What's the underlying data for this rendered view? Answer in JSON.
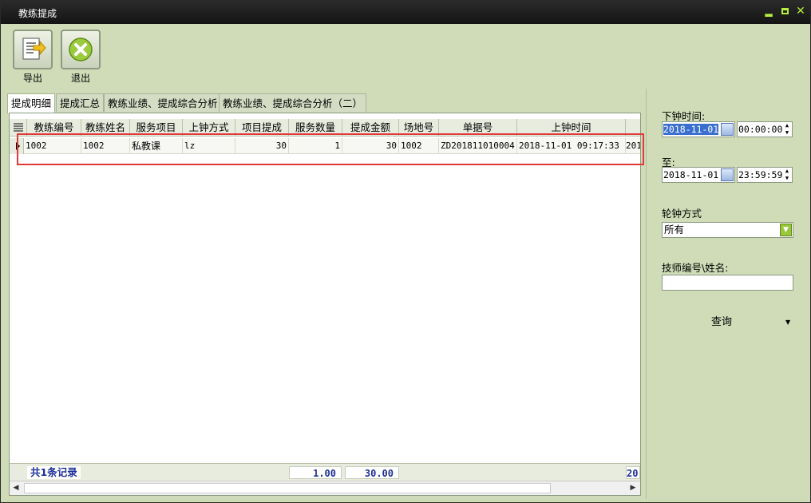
{
  "window": {
    "title": "教练提成",
    "controls": {
      "minimize": "▂",
      "close": "✕"
    }
  },
  "toolbar": {
    "export_label": "导出",
    "exit_label": "退出"
  },
  "tabs": [
    {
      "label": "提成明细",
      "active": true
    },
    {
      "label": "提成汇总",
      "active": false
    },
    {
      "label": "教练业绩、提成综合分析",
      "active": false
    },
    {
      "label": "教练业绩、提成综合分析（二）",
      "active": false
    }
  ],
  "grid": {
    "columns": [
      "教练编号",
      "教练姓名",
      "服务项目",
      "上钟方式",
      "项目提成",
      "服务数量",
      "提成金额",
      "场地号",
      "单据号",
      "上钟时间"
    ],
    "rows": [
      {
        "coach_id": "1002",
        "coach_name": "1002",
        "service": "私教课",
        "clock_mode": "lz",
        "item_commission": "30",
        "quantity": "1",
        "commission_amount": "30",
        "venue": "1002",
        "receipt_no": "ZD201811010004",
        "clock_time": "2018-11-01 09:17:33",
        "overflow": "201"
      }
    ],
    "footer": {
      "record_count": "共1条记录",
      "quantity_total": "1.00",
      "amount_total": "30.00",
      "overflow": "20"
    }
  },
  "filter": {
    "end_time_label": "下钟时间:",
    "start_date": "2018-11-01",
    "start_time": "00:00:00",
    "to_label": "至:",
    "end_date": "2018-11-01",
    "end_time": "23:59:59",
    "rotation_label": "轮钟方式",
    "rotation_value": "所有",
    "tech_label": "技师编号\\姓名:",
    "tech_value": "",
    "query_label": "查询"
  },
  "colors": {
    "titlebar": "#1c1c1c",
    "accent_green": "#b7ef3d",
    "panel_bg": "#cfdcb7",
    "highlight_border": "#e0393a",
    "footer_text": "#1d2f9a",
    "selection": "#3a6fd0"
  },
  "icons": {
    "export": "document-arrow-icon",
    "exit": "close-circle-icon",
    "calendar": "calendar-icon"
  }
}
